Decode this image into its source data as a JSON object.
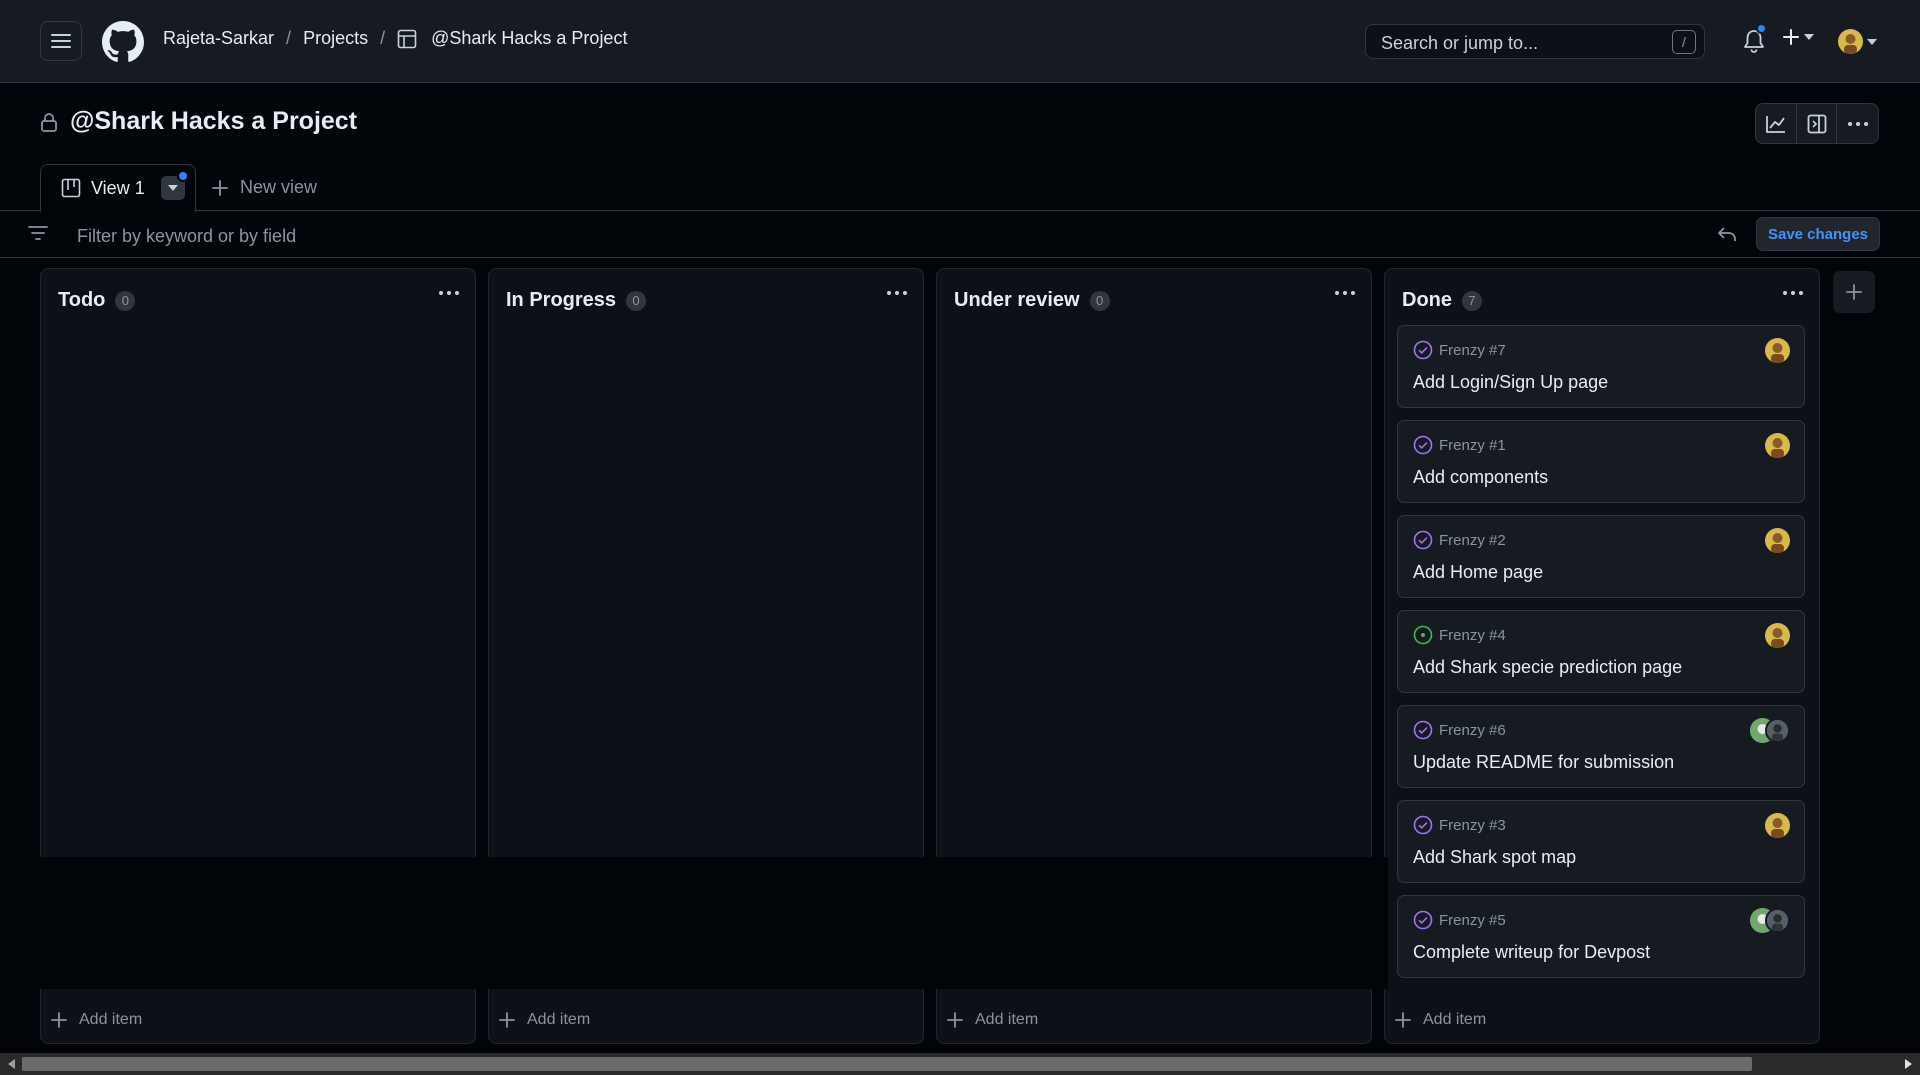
{
  "header": {
    "breadcrumbs": [
      "Rajeta-Sarkar",
      "Projects",
      "@Shark Hacks a Project"
    ],
    "separator": "/",
    "search_placeholder": "Search or jump to...",
    "search_shortcut": "/"
  },
  "project": {
    "title": "@Shark Hacks a Project"
  },
  "tabs": {
    "view_label": "View 1",
    "new_view_label": "New view"
  },
  "filter": {
    "placeholder": "Filter by keyword or by field",
    "save_label": "Save changes"
  },
  "columns": [
    {
      "name": "Todo",
      "count": "0",
      "add_label": "Add item"
    },
    {
      "name": "In Progress",
      "count": "0",
      "add_label": "Add item"
    },
    {
      "name": "Under review",
      "count": "0",
      "add_label": "Add item"
    },
    {
      "name": "Done",
      "count": "7",
      "add_label": "Add item"
    }
  ],
  "done_cards": [
    {
      "ref": "Frenzy #7",
      "title": "Add Login/Sign Up page",
      "status": "closed"
    },
    {
      "ref": "Frenzy #1",
      "title": "Add components",
      "status": "closed"
    },
    {
      "ref": "Frenzy #2",
      "title": "Add Home page",
      "status": "closed"
    },
    {
      "ref": "Frenzy #4",
      "title": "Add Shark specie prediction page",
      "status": "open"
    },
    {
      "ref": "Frenzy #6",
      "title": "Update README for submission",
      "status": "closed"
    },
    {
      "ref": "Frenzy #3",
      "title": "Add Shark spot map",
      "status": "closed"
    },
    {
      "ref": "Frenzy #5",
      "title": "Complete writeup for Devpost",
      "status": "closed"
    }
  ],
  "colors": {
    "accent": "#2f81f7",
    "closed_icon": "#a371f7",
    "open_icon": "#3fb950"
  }
}
